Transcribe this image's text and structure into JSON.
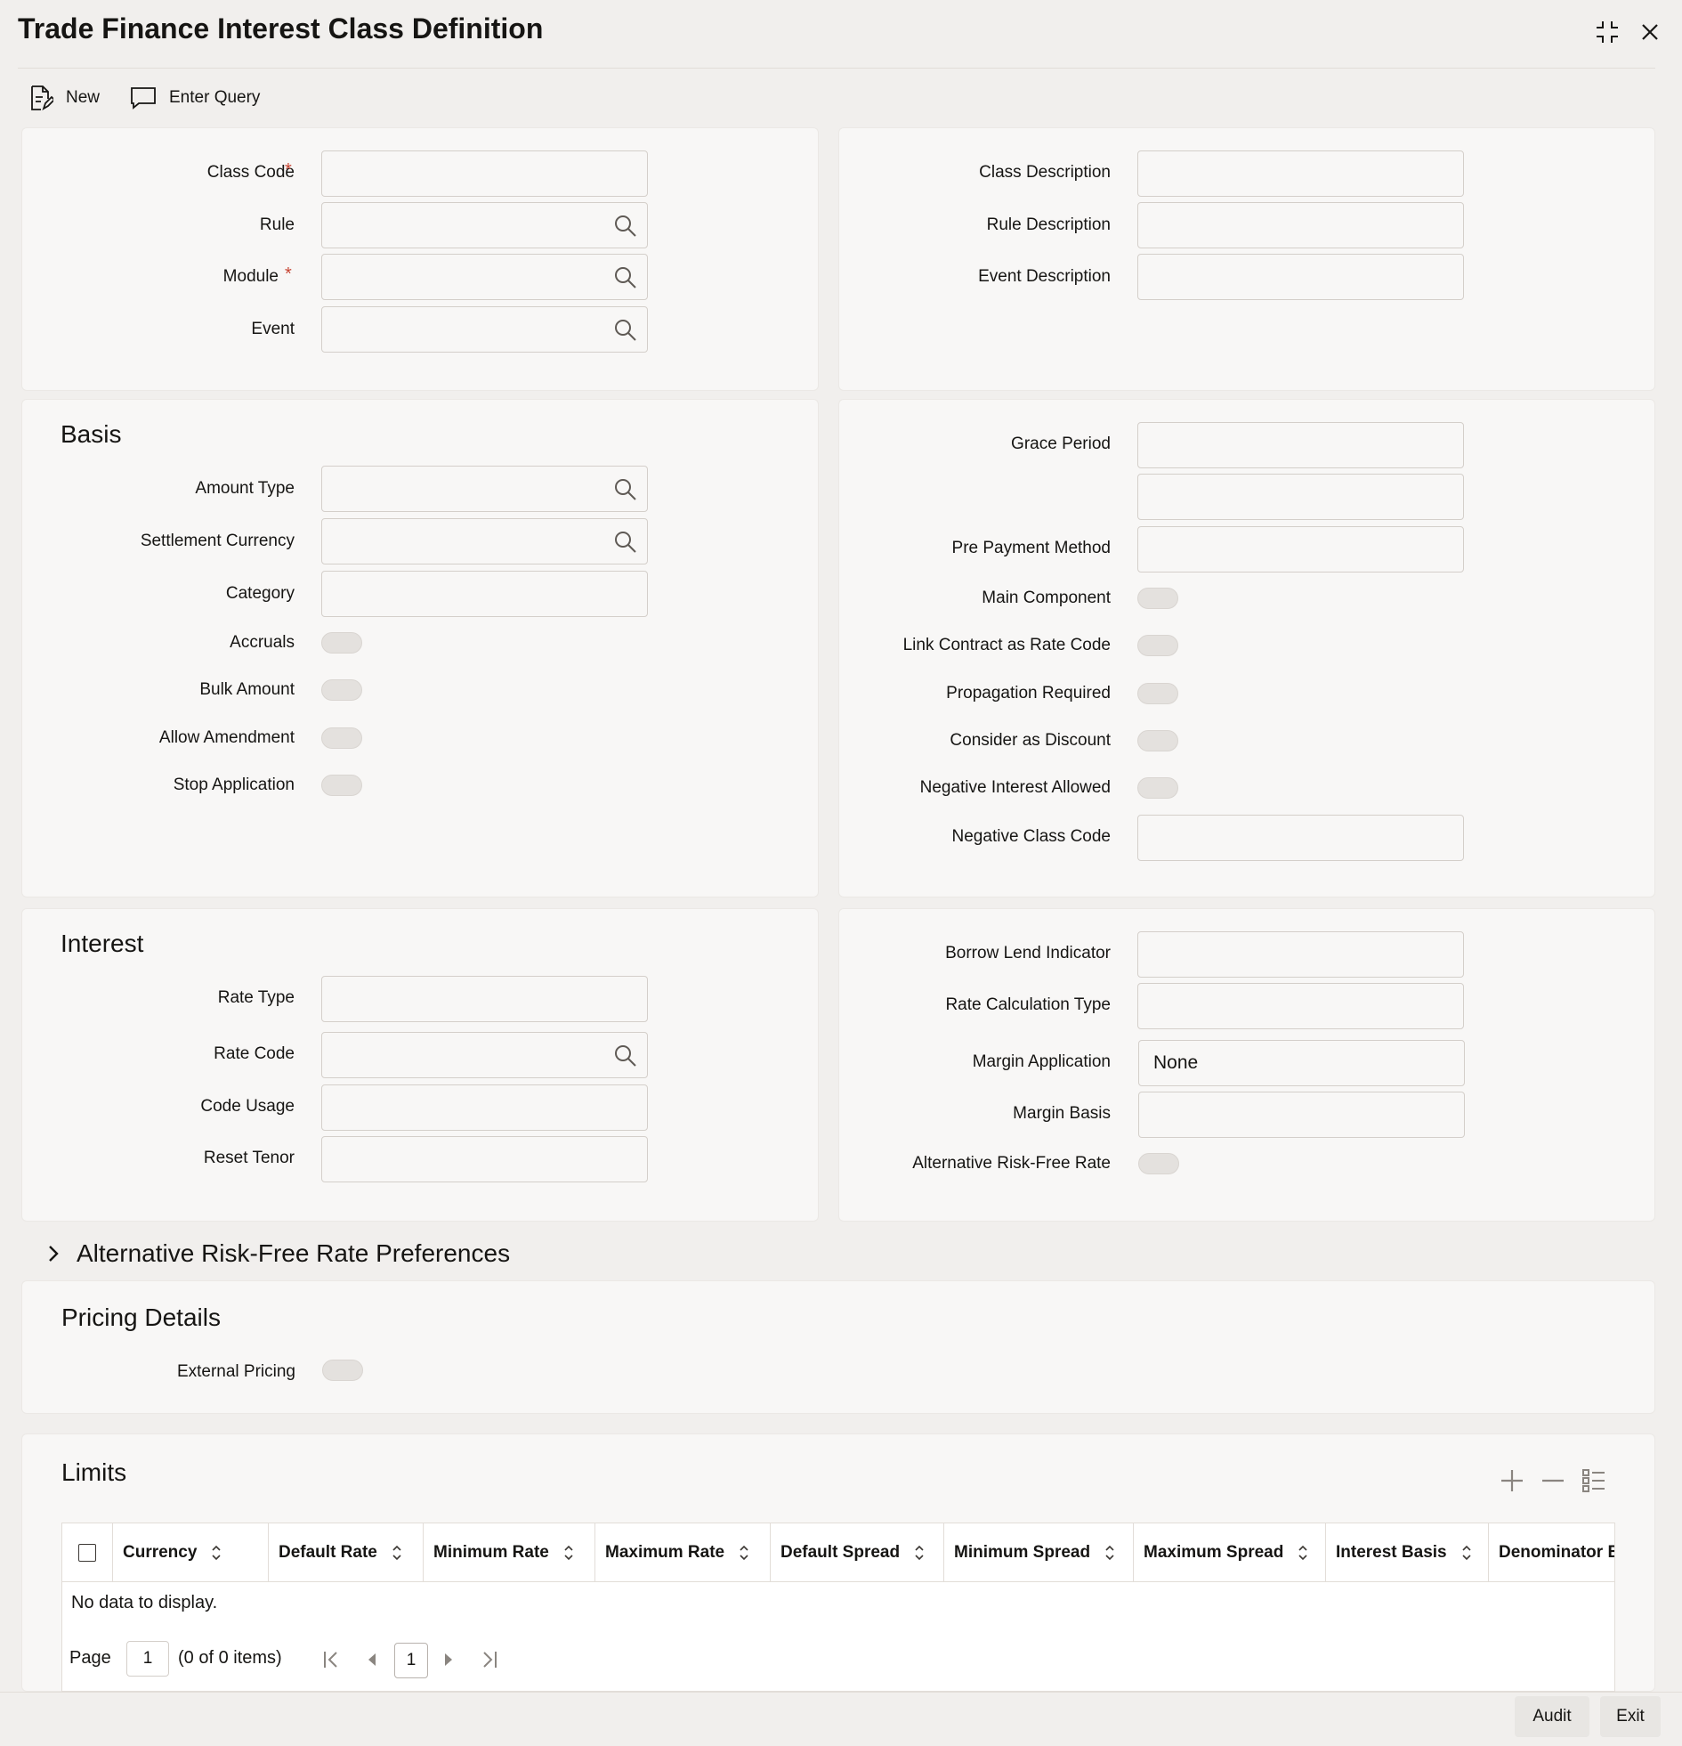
{
  "window": {
    "title": "Trade Finance Interest Class Definition"
  },
  "toolbar": {
    "new_label": "New",
    "enter_query_label": "Enter Query"
  },
  "header_panel": {
    "class_code_label": "Class Code",
    "rule_label": "Rule",
    "module_label": "Module",
    "event_label": "Event",
    "class_description_label": "Class Description",
    "rule_description_label": "Rule Description",
    "event_description_label": "Event Description",
    "required_marker": "*"
  },
  "basis": {
    "title": "Basis",
    "amount_type_label": "Amount Type",
    "settlement_currency_label": "Settlement Currency",
    "category_label": "Category",
    "accruals_label": "Accruals",
    "bulk_amount_label": "Bulk Amount",
    "allow_amendment_label": "Allow Amendment",
    "stop_application_label": "Stop Application",
    "grace_period_label": "Grace Period",
    "pre_payment_method_label": "Pre Payment Method",
    "main_component_label": "Main Component",
    "link_contract_label": "Link Contract as Rate Code",
    "propagation_required_label": "Propagation Required",
    "consider_as_discount_label": "Consider as Discount",
    "negative_interest_allowed_label": "Negative Interest Allowed",
    "negative_class_code_label": "Negative Class Code"
  },
  "interest": {
    "title": "Interest",
    "rate_type_label": "Rate Type",
    "rate_code_label": "Rate Code",
    "code_usage_label": "Code Usage",
    "reset_tenor_label": "Reset Tenor",
    "borrow_lend_label": "Borrow Lend Indicator",
    "rate_calc_type_label": "Rate Calculation Type",
    "margin_application_label": "Margin Application",
    "margin_application_value": "None",
    "margin_basis_label": "Margin Basis",
    "arfr_label": "Alternative Risk-Free Rate"
  },
  "arfr_prefs": {
    "title": "Alternative Risk-Free Rate Preferences"
  },
  "pricing": {
    "title": "Pricing Details",
    "external_pricing_label": "External Pricing"
  },
  "limits": {
    "title": "Limits",
    "columns": [
      "Currency",
      "Default Rate",
      "Minimum Rate",
      "Maximum Rate",
      "Default Spread",
      "Minimum Spread",
      "Maximum Spread",
      "Interest Basis",
      "Denominator Ba"
    ],
    "empty_text": "No data to display.",
    "page_label": "Page",
    "page_value": "1",
    "items_text": "(0 of 0 items)",
    "current_page": "1"
  },
  "footer": {
    "audit_label": "Audit",
    "exit_label": "Exit"
  }
}
